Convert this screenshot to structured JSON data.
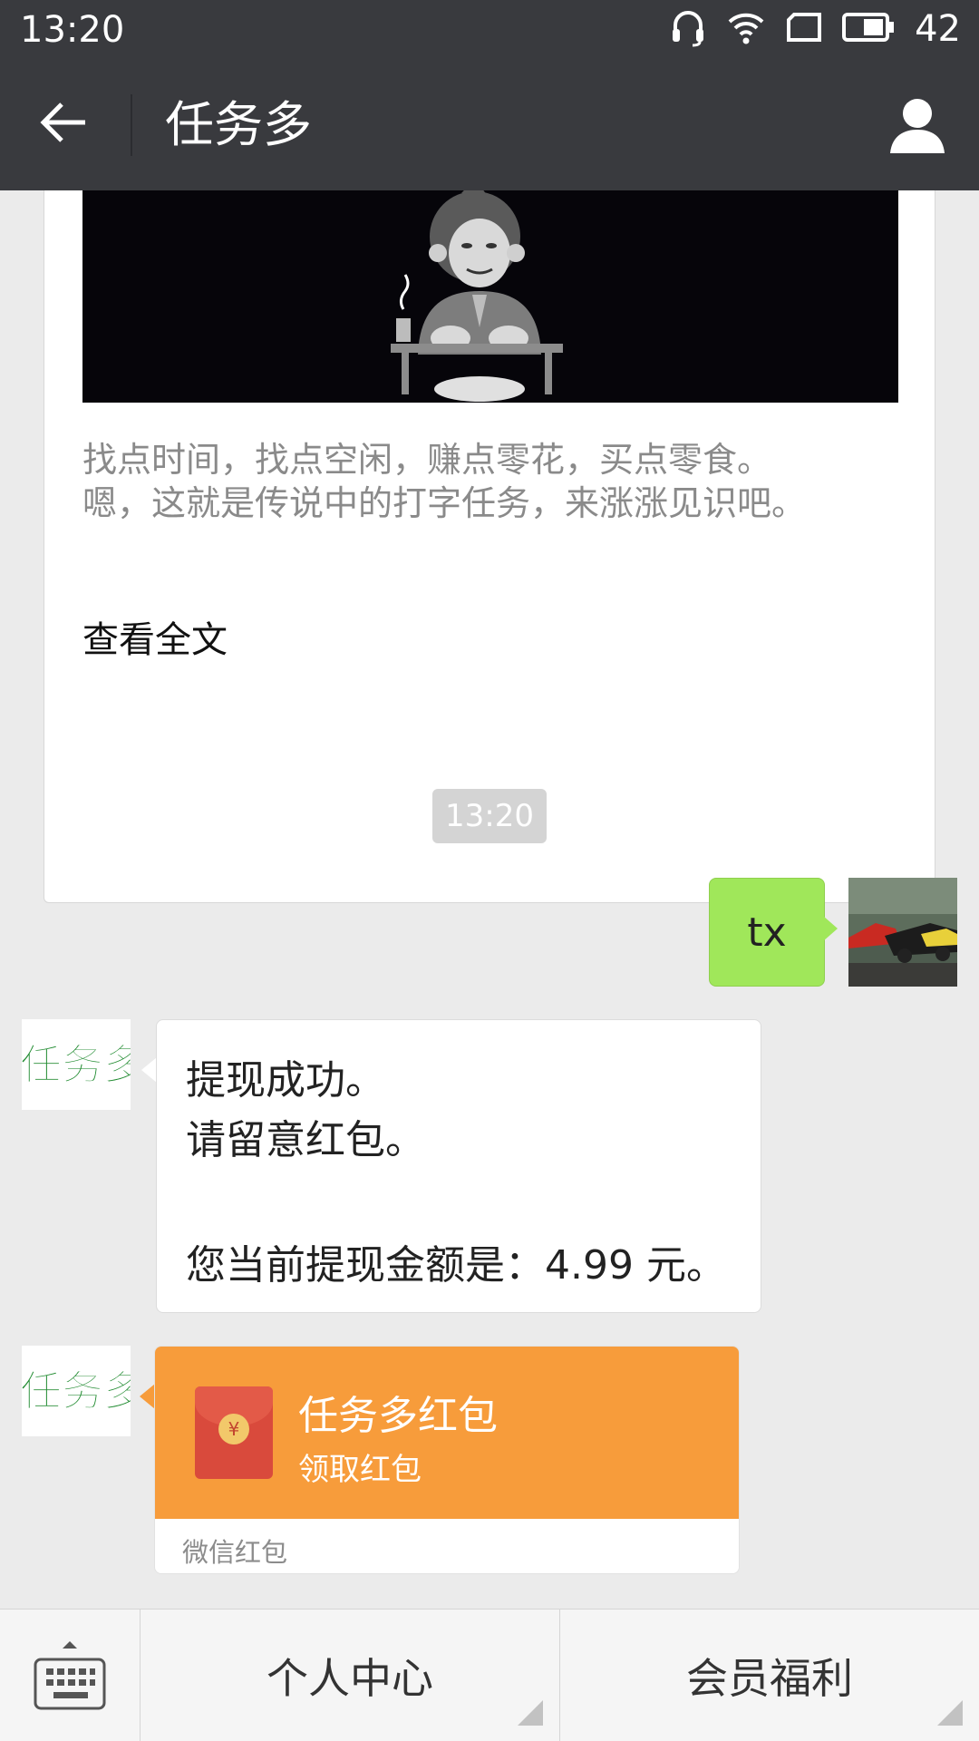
{
  "status_bar": {
    "time": "13:20",
    "battery": "42"
  },
  "header": {
    "title": "任务多"
  },
  "article": {
    "lines": [
      "找点时间，找点空闲，赚点零花，买点零食。",
      "嗯，这就是传说中的打字任务，来涨涨见识吧。"
    ],
    "read_more": "查看全文"
  },
  "timestamp": "13:20",
  "sent_message": {
    "text": "tx"
  },
  "bot_logo_text": "任务多",
  "reply_message": {
    "lines": [
      "提现成功。",
      "请留意红包。",
      "您当前提现金额是：4.99 元。"
    ]
  },
  "red_packet": {
    "title": "任务多红包",
    "subtitle": "领取红包",
    "footer": "微信红包",
    "coin_symbol": "¥"
  },
  "bottom_menu": {
    "items": [
      "个人中心",
      "会员福利"
    ]
  },
  "colors": {
    "header_bg": "#393a3e",
    "chat_bg": "#ebebeb",
    "sent_bubble": "#a0e75a",
    "red_packet": "#f79c3b",
    "bot_logo_green": "#1e8a2e"
  }
}
